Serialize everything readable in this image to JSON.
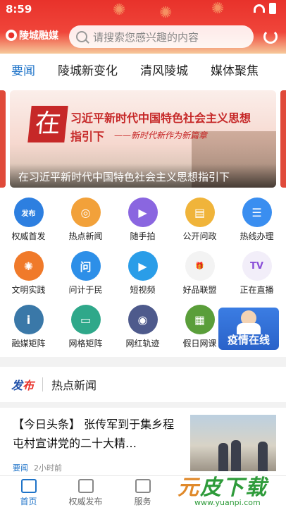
{
  "status": {
    "time": "8:59"
  },
  "header": {
    "logo": "陵城融媒",
    "search_placeholder": "请搜索您感兴趣的内容"
  },
  "tabs": [
    {
      "label": "要闻",
      "active": true
    },
    {
      "label": "陵城新变化"
    },
    {
      "label": "清风陵城"
    },
    {
      "label": "媒体聚焦"
    }
  ],
  "banner": {
    "big_char": "在",
    "line1": "习近平新时代中国特色社会主义思想",
    "line2": "指引下",
    "slogan": "——新时代新作为新篇章",
    "caption": "在习近平新时代中国特色社会主义思想指引下"
  },
  "grid": [
    {
      "label": "权威首发",
      "icon": "publish-icon",
      "color": "#2d7fe0",
      "glyph": "发布"
    },
    {
      "label": "热点新闻",
      "icon": "target-news-icon",
      "color": "#f2a13a",
      "glyph": "◎"
    },
    {
      "label": "随手拍",
      "icon": "video-camera-icon",
      "color": "#8a66e0",
      "glyph": "▶"
    },
    {
      "label": "公开问政",
      "icon": "document-icon",
      "color": "#f0b43a",
      "glyph": "▤"
    },
    {
      "label": "热线办理",
      "icon": "hotline-icon",
      "color": "#3a8ef0",
      "glyph": "☰"
    },
    {
      "label": "文明实践",
      "icon": "palm-icon",
      "color": "#f07a2a",
      "glyph": "✺"
    },
    {
      "label": "问计于民",
      "icon": "ask-icon",
      "color": "#2d8fe8",
      "glyph": "问"
    },
    {
      "label": "短视频",
      "icon": "film-icon",
      "color": "#2a9de8",
      "glyph": "▶"
    },
    {
      "label": "好品联盟",
      "icon": "gift-icon",
      "color": "#f3f3f3",
      "glyph": "🎁"
    },
    {
      "label": "正在直播",
      "icon": "tv-icon",
      "color": "#f2eef9",
      "glyph": "TV"
    },
    {
      "label": "融媒矩阵",
      "icon": "info-icon",
      "color": "#3a78a8",
      "glyph": "i"
    },
    {
      "label": "网格矩阵",
      "icon": "chat-icon",
      "color": "#2fa88a",
      "glyph": "▭"
    },
    {
      "label": "网红轨迹",
      "icon": "location-pin-icon",
      "color": "#4e5a8c",
      "glyph": "◉"
    },
    {
      "label": "假日网课",
      "icon": "printer-icon",
      "color": "#5a9e3a",
      "glyph": "▦"
    }
  ],
  "epidemic": {
    "label": "疫情在线"
  },
  "section": {
    "brand_a": "发",
    "brand_b": "布",
    "title": "热点新闻"
  },
  "news": {
    "headline": "【今日头条】 张传军到于集乡程屯村宣讲党的二十大精…",
    "source": "要闻",
    "time": "2小时前"
  },
  "bottomnav": [
    {
      "label": "首页",
      "icon": "home-icon",
      "active": true
    },
    {
      "label": "权威发布",
      "icon": "list-icon"
    },
    {
      "label": "服务",
      "icon": "bookmark-icon"
    },
    {
      "label": "",
      "icon": "blank-icon"
    },
    {
      "label": "",
      "icon": "blank-icon"
    }
  ],
  "watermark": {
    "text_a": "元",
    "text_b": "皮下载",
    "url": "www.yuanpi.com"
  }
}
